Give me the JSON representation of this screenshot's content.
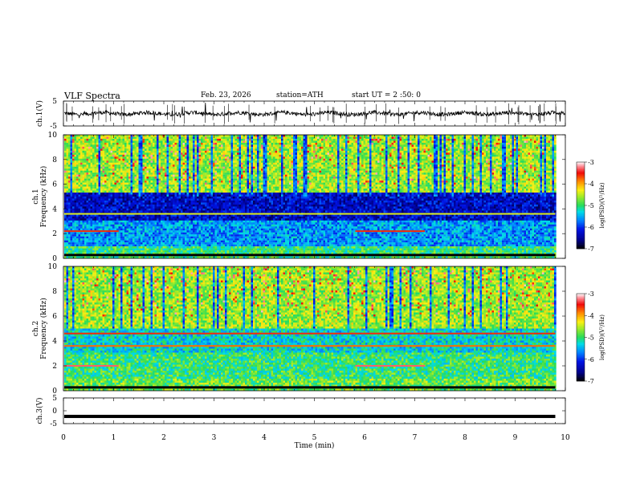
{
  "header": {
    "title": "VLF  Spectra",
    "date": "Feb. 23, 2026",
    "station": "station=ATH",
    "start_ut": "start  UT  =   2  :50: 0"
  },
  "chart_data": [
    {
      "type": "line",
      "name": "ch1-waveform",
      "ylabel": "ch.1(V)",
      "ylim": [
        -5,
        5
      ],
      "yticks": [
        "5",
        "-5"
      ],
      "baseline": 0,
      "xlim": [
        0,
        10
      ]
    },
    {
      "type": "heatmap",
      "name": "ch1-spectrogram",
      "ylabel": "ch.1\nFrequency (kHz)",
      "ylim": [
        0,
        10
      ],
      "yticks": [
        "0",
        "2",
        "4",
        "6",
        "8",
        "10"
      ],
      "xlim": [
        0,
        9.8
      ],
      "colorbar": {
        "label": "log(PSD)(V²/Hz)",
        "range": [
          -7,
          -3
        ],
        "ticks": [
          "-3",
          "-4",
          "-5",
          "-6",
          "-7"
        ]
      },
      "bands": [
        {
          "f0": 10.0,
          "f1": 5.3,
          "level": -4.6
        },
        {
          "f0": 5.3,
          "f1": 3.0,
          "level": -6.3
        },
        {
          "f0": 3.0,
          "f1": 1.0,
          "level": -5.6
        },
        {
          "f0": 1.0,
          "f1": 0.0,
          "level": -5.0
        }
      ],
      "lines": [
        {
          "f": 3.6,
          "t0": 0,
          "t1": 9.8,
          "level": -4.4
        },
        {
          "f": 2.2,
          "t0": 0,
          "t1": 1.1,
          "level": -3.6
        },
        {
          "f": 2.2,
          "t0": 5.8,
          "t1": 7.2,
          "level": -3.6
        },
        {
          "f": 0.3,
          "t0": 0,
          "t1": 9.8,
          "level": -7
        }
      ]
    },
    {
      "type": "heatmap",
      "name": "ch2-spectrogram",
      "ylabel": "ch.2\nFrequency (kHz)",
      "ylim": [
        0,
        10
      ],
      "yticks": [
        "0",
        "2",
        "4",
        "6",
        "8",
        "10"
      ],
      "xlim": [
        0,
        9.8
      ],
      "colorbar": {
        "label": "log(PSD)(V²/Hz)",
        "range": [
          -7,
          -3
        ],
        "ticks": [
          "-3",
          "-4",
          "-5",
          "-6",
          "-7"
        ]
      },
      "bands": [
        {
          "f0": 10.0,
          "f1": 5.0,
          "level": -4.6
        },
        {
          "f0": 5.0,
          "f1": 3.0,
          "level": -5.3
        },
        {
          "f0": 3.0,
          "f1": 1.0,
          "level": -5.0
        },
        {
          "f0": 1.0,
          "f1": 0.0,
          "level": -4.8
        }
      ],
      "lines": [
        {
          "f": 4.6,
          "t0": 0,
          "t1": 9.8,
          "level": -3.6
        },
        {
          "f": 3.6,
          "t0": 0,
          "t1": 9.8,
          "level": -3.8
        },
        {
          "f": 2.0,
          "t0": 0,
          "t1": 1.1,
          "level": -3.3
        },
        {
          "f": 2.0,
          "t0": 5.8,
          "t1": 7.2,
          "level": -3.3
        },
        {
          "f": 0.3,
          "t0": 0,
          "t1": 9.8,
          "level": -7
        }
      ]
    },
    {
      "type": "line",
      "name": "ch3-waveform",
      "ylabel": "ch.3(V)",
      "ylim": [
        -5,
        5
      ],
      "yticks": [
        "5",
        "0",
        "-5"
      ],
      "baseline": -2.2,
      "xlim": [
        0,
        9.8
      ]
    }
  ],
  "time_axis": {
    "xlabel": "Time (min)",
    "xlim": [
      0,
      10
    ],
    "ticks": [
      "0",
      "1",
      "2",
      "3",
      "4",
      "5",
      "6",
      "7",
      "8",
      "9",
      "10"
    ]
  }
}
